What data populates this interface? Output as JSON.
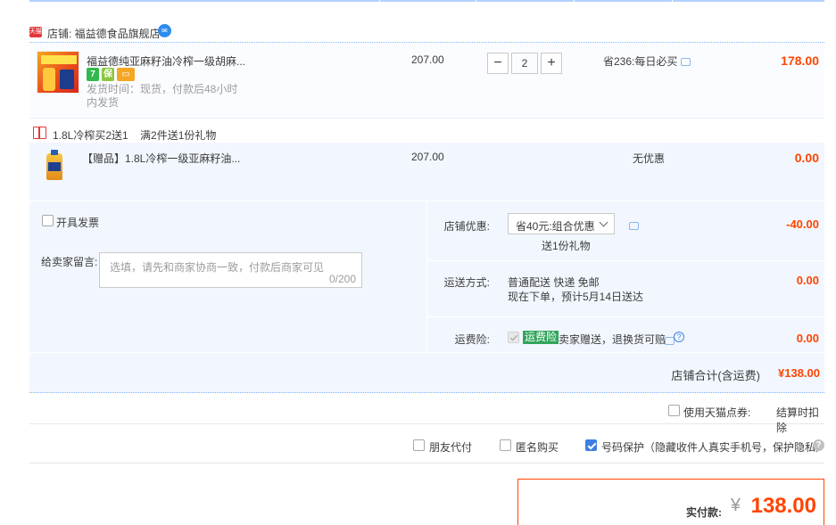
{
  "shop": {
    "badge": "天猫",
    "label": "店铺: 福益德食品旗舰店",
    "wangwang_icon": "wangwang-chat-icon"
  },
  "items": [
    {
      "title": "福益德纯亚麻籽油冷榨一级胡麻...",
      "shipping": "发货时间：现货，付款后48小时内发货",
      "price": "207.00",
      "quantity": "2",
      "qty_minus": "−",
      "qty_plus": "+",
      "promo": "省236:每日必买",
      "subtotal": "178.00",
      "icons": [
        {
          "name": "7day-return-icon",
          "glyph": "7",
          "color": "#31b94b"
        },
        {
          "name": "guarantee-icon",
          "glyph": "保",
          "color": "#8cc63e"
        },
        {
          "name": "credit-card-icon",
          "glyph": "▭",
          "color": "#f5a623"
        }
      ]
    },
    {
      "title": "【赠品】1.8L冷榨一级亚麻籽油...",
      "price": "207.00",
      "promo": "无优惠",
      "subtotal": "0.00"
    }
  ],
  "gift": {
    "icon": "gift-icon",
    "text": "1.8L冷榨买2送1    满2件送1份礼物"
  },
  "invoice": {
    "label": "开具发票",
    "checked": false
  },
  "message": {
    "label": "给卖家留言:",
    "placeholder": "选填，请先和商家协商一致，付款后商家可见",
    "count": "0/200"
  },
  "shop_discount": {
    "label": "店铺优惠:",
    "selected": "省40元:组合优惠",
    "note": "送1份礼物",
    "value": "-40.00"
  },
  "delivery": {
    "label": "运送方式:",
    "method": "普通配送 快递 免邮",
    "eta": "现在下单，预计5月14日送达",
    "value": "0.00"
  },
  "insurance": {
    "label": "运费险:",
    "badge": "运费险",
    "text": "卖家赠送，退换货可赔",
    "value": "0.00"
  },
  "shop_total": {
    "label": "店铺合计(含运费)",
    "value": "¥138.00"
  },
  "coupon": {
    "label": "使用天猫点券:",
    "note": "结算时扣除"
  },
  "options": [
    {
      "label": "朋友代付",
      "checked": false
    },
    {
      "label": "匿名购买",
      "checked": false
    },
    {
      "label": "号码保护（隐藏收件人真实手机号，保护隐私）",
      "checked": true
    }
  ],
  "payment": {
    "label": "实付款:",
    "currency": "¥",
    "value": "138.00"
  },
  "colors": {
    "accent": "#ff4400",
    "link_blue": "#3d7fe2",
    "row_bg": "#f2f7ff"
  }
}
